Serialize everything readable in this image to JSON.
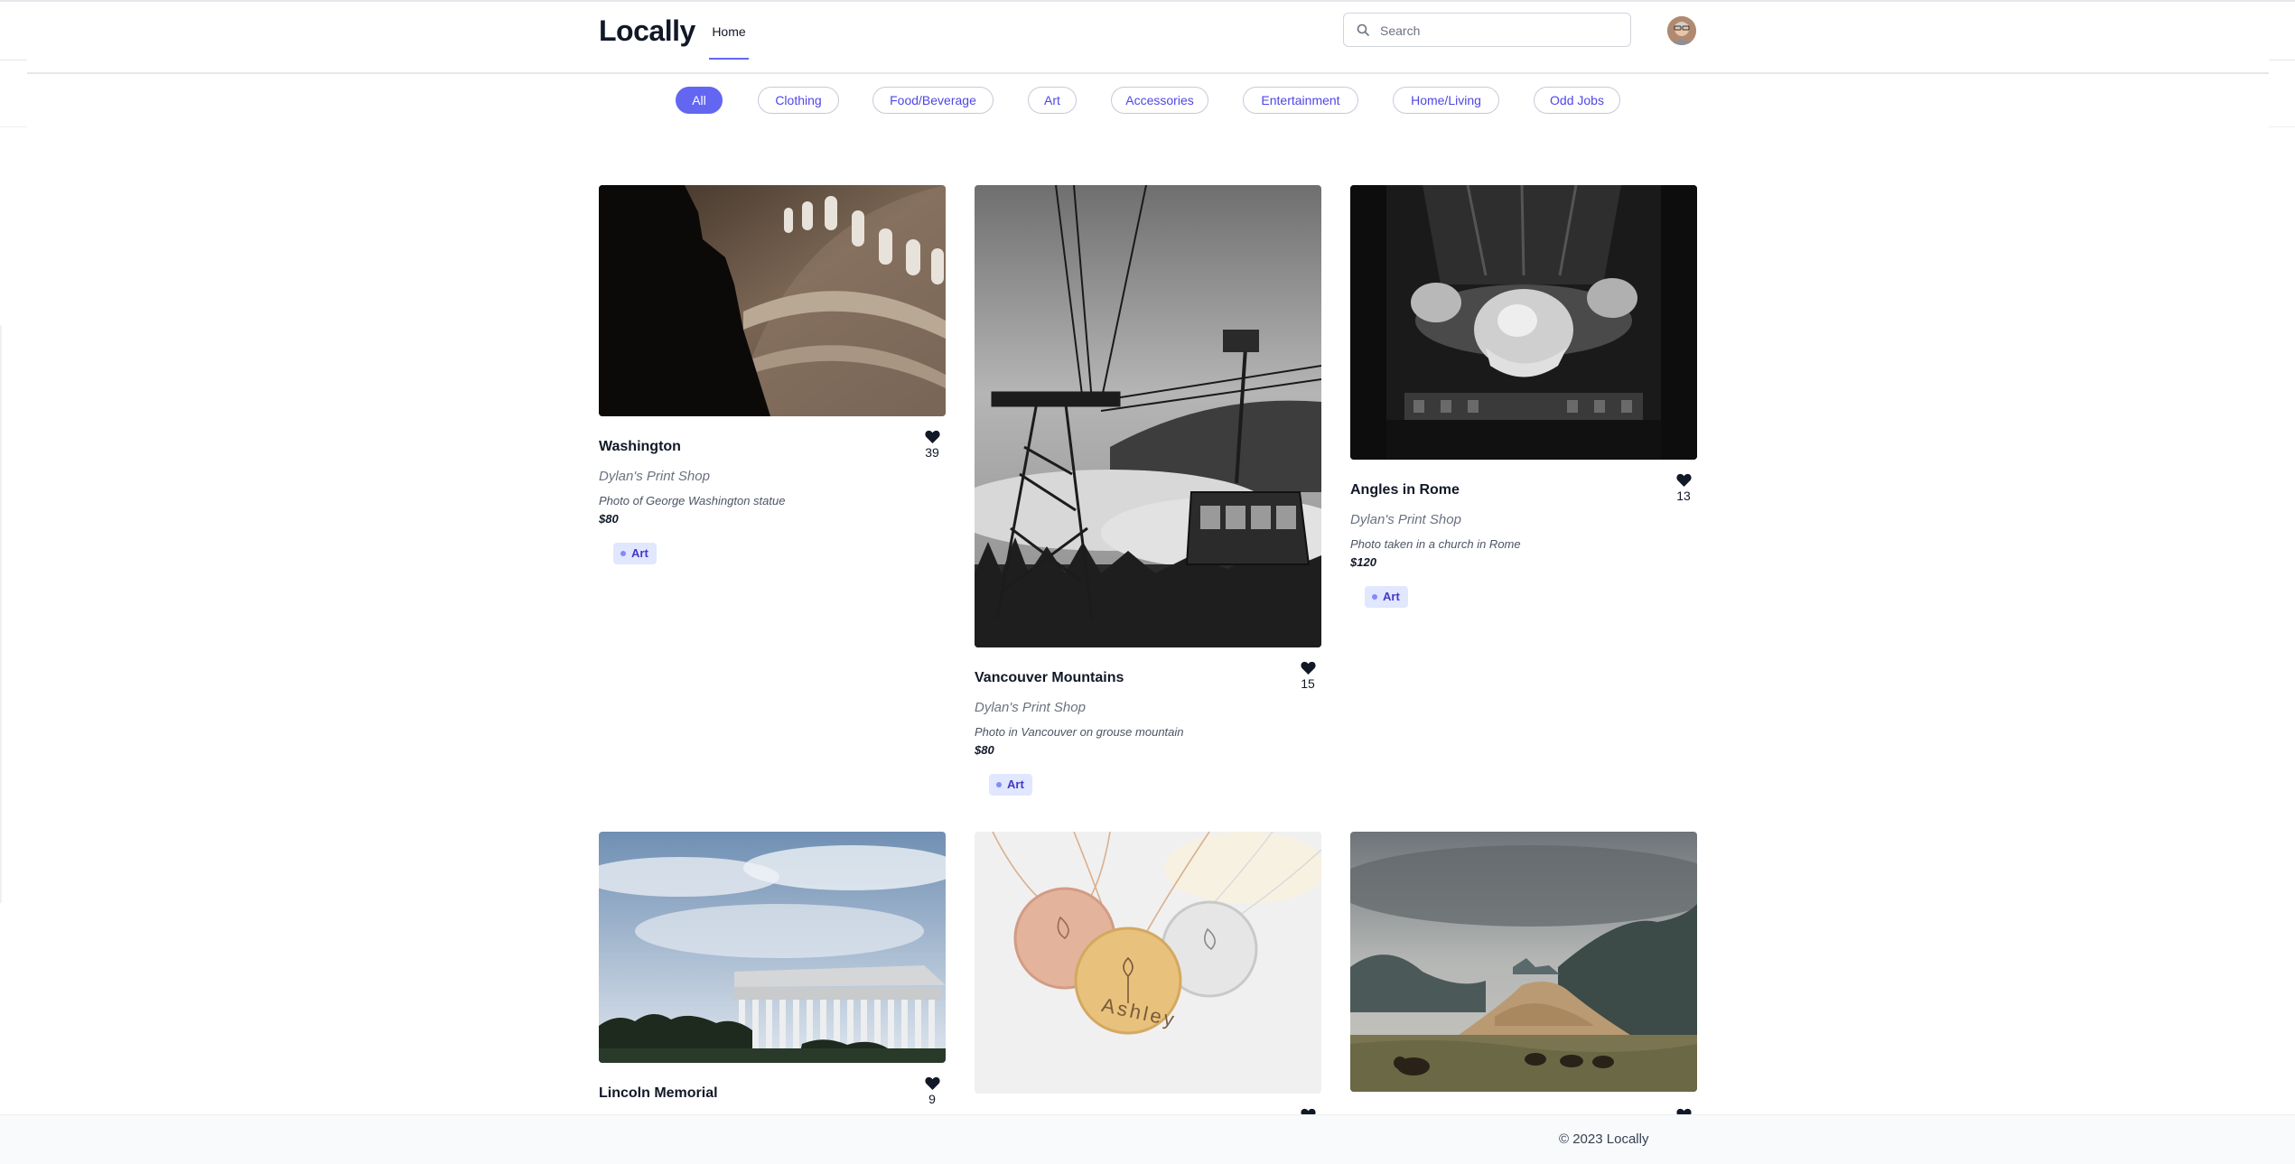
{
  "app": {
    "name": "Locally"
  },
  "nav": {
    "home_label": "Home"
  },
  "search": {
    "placeholder": "Search",
    "value": ""
  },
  "categories": [
    {
      "label": "All",
      "active": true
    },
    {
      "label": "Clothing",
      "active": false
    },
    {
      "label": "Food/Beverage",
      "active": false
    },
    {
      "label": "Art",
      "active": false
    },
    {
      "label": "Accessories",
      "active": false
    },
    {
      "label": "Entertainment",
      "active": false
    },
    {
      "label": "Home/Living",
      "active": false
    },
    {
      "label": "Odd Jobs",
      "active": false
    }
  ],
  "listings": [
    {
      "title": "Washington",
      "likes": "39",
      "shop": "Dylan's Print Shop",
      "description": "Photo of George Washington statue",
      "price": "$80",
      "tag": "Art"
    },
    {
      "title": "Vancouver Mountains",
      "likes": "15",
      "shop": "Dylan's Print Shop",
      "description": "Photo in Vancouver on grouse mountain",
      "price": "$80",
      "tag": "Art"
    },
    {
      "title": "Angles in Rome",
      "likes": "13",
      "shop": "Dylan's Print Shop",
      "description": "Photo taken in a church in Rome",
      "price": "$120",
      "tag": "Art"
    },
    {
      "title": "Lincoln Memorial",
      "likes": "9"
    },
    {
      "title": "",
      "likes": ""
    },
    {
      "title": "",
      "likes": ""
    }
  ],
  "footer": {
    "copyright": "© 2023 Locally"
  },
  "colors": {
    "accent": "#6366f1",
    "tag_bg": "#e0e7ff",
    "footer_bg": "#f8fafc"
  },
  "icons": {
    "search": "search-icon",
    "like": "heart-icon",
    "tag": "dot-icon"
  }
}
